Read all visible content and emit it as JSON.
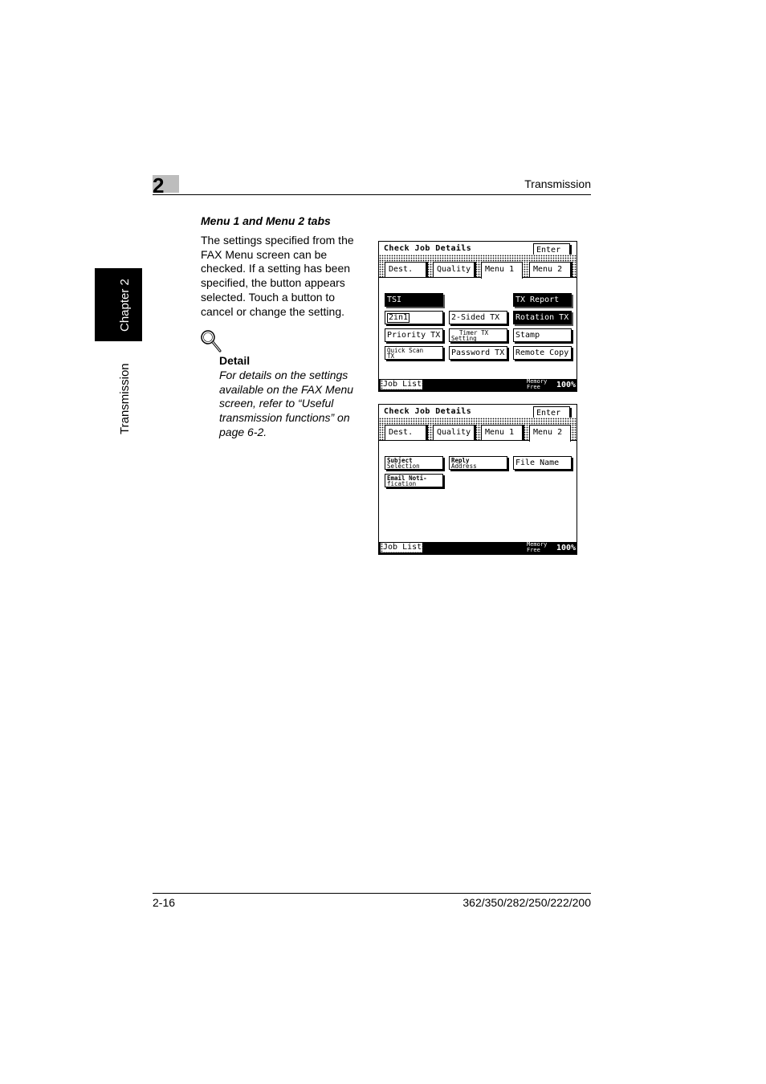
{
  "header": {
    "chapter_number": "2",
    "title": "Transmission"
  },
  "side_tab": {
    "chapter": "Chapter 2",
    "section": "Transmission"
  },
  "section": {
    "heading": "Menu 1 and Menu 2 tabs",
    "intro": "The settings specified from the FAX Menu screen can be checked. If a setting has been specified, the button appears selected. Touch a button to cancel or change the setting."
  },
  "detail": {
    "icon": "magnifier-icon",
    "label": "Detail",
    "text": "For details on the settings available on the FAX Menu screen, refer to “Useful transmission functions” on page 6-2."
  },
  "panel1": {
    "title": "Check Job Details",
    "enter": "Enter",
    "tabs": [
      "Dest.",
      "Quality",
      "Menu 1",
      "Menu 2"
    ],
    "selected_tab": "Menu 1",
    "buttons": {
      "tsi": "TSI",
      "tx_report": "TX Report",
      "two_in_one": "2in1",
      "two_sided": "2-Sided TX",
      "rotation": "Rotation TX",
      "priority": "Priority TX",
      "timer_1": "Timer TX",
      "timer_2": "Setting",
      "stamp": "Stamp",
      "quick_scan_1": "Quick Scan",
      "quick_scan_2": "TX",
      "password": "Password TX",
      "remote_copy": "Remote Copy"
    },
    "job_list": "Job List",
    "memory_1": "Memory",
    "memory_2": "Free",
    "memory_pct": "100%"
  },
  "panel2": {
    "title": "Check Job Details",
    "enter": "Enter",
    "tabs": [
      "Dest.",
      "Quality",
      "Menu 1",
      "Menu 2"
    ],
    "selected_tab": "Menu 2",
    "buttons": {
      "subject_1": "Subject",
      "subject_2": "Selection",
      "reply_1": "Reply",
      "reply_2": "Address",
      "file_name": "File Name",
      "email_1": "Email Noti-",
      "email_2": "fication"
    },
    "job_list": "Job List",
    "memory_1": "Memory",
    "memory_2": "Free",
    "memory_pct": "100%"
  },
  "footer": {
    "page": "2-16",
    "models": "362/350/282/250/222/200"
  }
}
